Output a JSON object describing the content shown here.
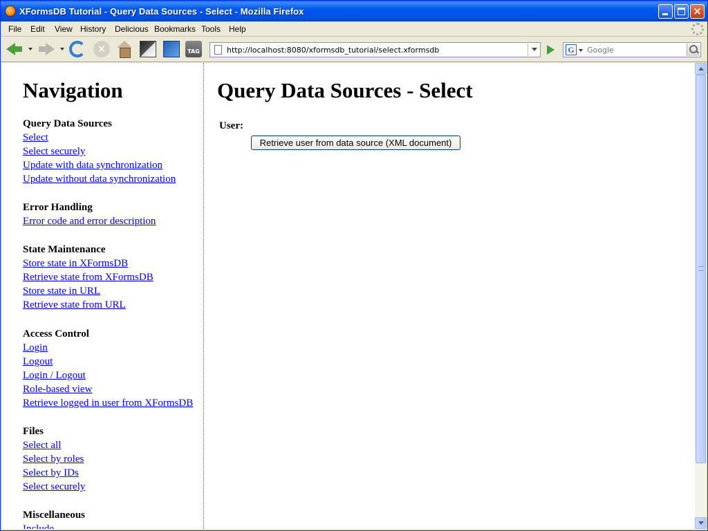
{
  "window": {
    "title": "XFormsDB Tutorial - Query Data Sources - Select - Mozilla Firefox",
    "close_glyph": "×"
  },
  "menubar": {
    "items": [
      "File",
      "Edit",
      "View",
      "History",
      "Delicious",
      "Bookmarks",
      "Tools",
      "Help"
    ]
  },
  "toolbar": {
    "stop_glyph": "×",
    "tag_label": "TAG",
    "url": "http://localhost:8080/xformsdb_tutorial/select.xformsdb",
    "search_engine_glyph": "G",
    "search_placeholder": "Google"
  },
  "nav": {
    "title": "Navigation",
    "sections": [
      {
        "heading": "Query Data Sources",
        "links": [
          "Select",
          "Select securely",
          "Update with data synchronization",
          "Update without data synchronization"
        ]
      },
      {
        "heading": "Error Handling",
        "links": [
          "Error code and error description"
        ]
      },
      {
        "heading": "State Maintenance",
        "links": [
          "Store state in XFormsDB",
          "Retrieve state from XFormsDB",
          "Store state in URL",
          "Retrieve state from URL"
        ]
      },
      {
        "heading": "Access Control",
        "links": [
          "Login",
          "Logout",
          "Login / Logout",
          "Role-based view",
          "Retrieve logged in user from XFormsDB"
        ]
      },
      {
        "heading": "Files",
        "links": [
          "Select all",
          "Select by roles",
          "Select by IDs",
          "Select securely"
        ]
      },
      {
        "heading": "Miscellaneous",
        "links": [
          "Include"
        ]
      }
    ]
  },
  "main": {
    "title": "Query Data Sources - Select",
    "field_label": "User:",
    "button_label": "Retrieve user from data source (XML document)"
  }
}
